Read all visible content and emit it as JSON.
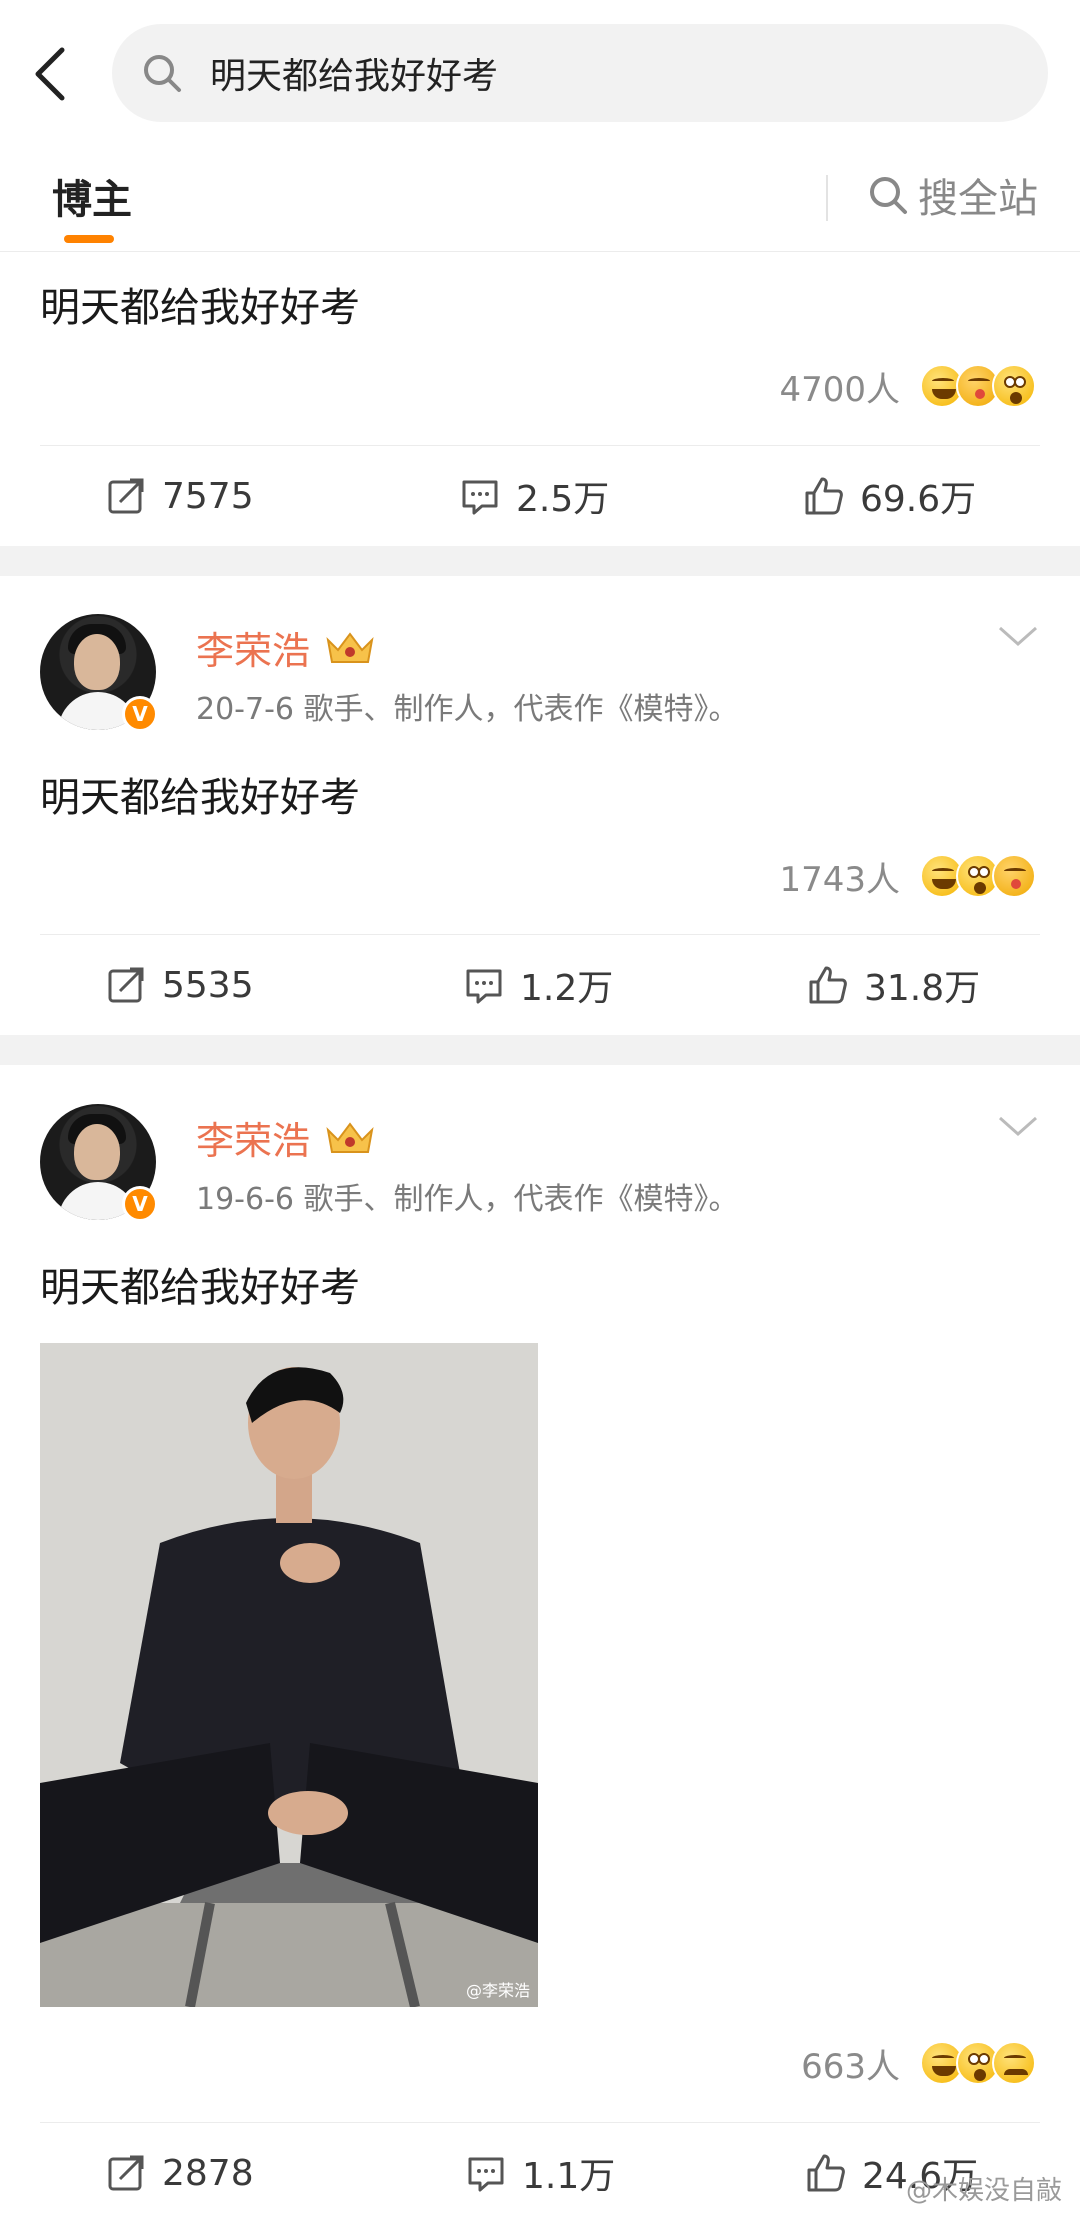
{
  "search": {
    "query": "明天都给我好好考"
  },
  "tabs": {
    "blogger": "博主",
    "search_all": "搜全站"
  },
  "posts": [
    {
      "text": "明天都给我好好考",
      "reaction_count": "4700人",
      "emojis": [
        "grin-emoji",
        "kiss-emoji",
        "wow-emoji"
      ],
      "repost": "7575",
      "comment": "2.5万",
      "like": "69.6万"
    },
    {
      "author": "李荣浩",
      "meta": "20-7-6  歌手、制作人，代表作《模特》。",
      "text": "明天都给我好好考",
      "reaction_count": "1743人",
      "emojis": [
        "grin-emoji",
        "wow-emoji",
        "kiss-emoji"
      ],
      "repost": "5535",
      "comment": "1.2万",
      "like": "31.8万"
    },
    {
      "author": "李荣浩",
      "meta": "19-6-6  歌手、制作人，代表作《模特》。",
      "text": "明天都给我好好考",
      "photo_watermark": "@李荣浩",
      "reaction_count": "663人",
      "emojis": [
        "grin-emoji",
        "wow-emoji",
        "sad-emoji"
      ],
      "repost": "2878",
      "comment": "1.1万",
      "like": "24.6万"
    }
  ],
  "badge_letter": "V",
  "corner_watermark": "@木娱没自敲",
  "colors": {
    "accent": "#ff8200",
    "author_name": "#eb7350",
    "verified": "#ff8a00"
  }
}
